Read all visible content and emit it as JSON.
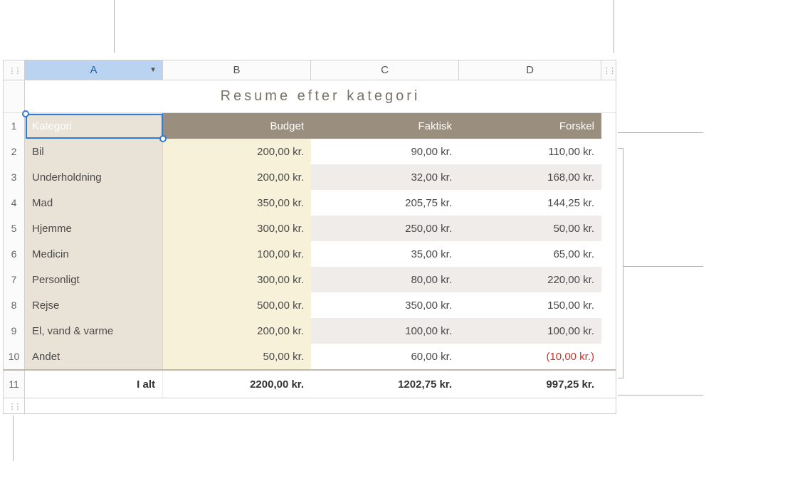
{
  "columns": [
    "A",
    "B",
    "C",
    "D"
  ],
  "title": "Resume efter kategori",
  "headers": {
    "category": "Kategori",
    "budget": "Budget",
    "actual": "Faktisk",
    "diff": "Forskel"
  },
  "rows": [
    {
      "n": "2",
      "cat": "Bil",
      "b": "200,00 kr.",
      "c": "90,00 kr.",
      "d": "110,00 kr."
    },
    {
      "n": "3",
      "cat": "Underholdning",
      "b": "200,00 kr.",
      "c": "32,00 kr.",
      "d": "168,00 kr."
    },
    {
      "n": "4",
      "cat": "Mad",
      "b": "350,00 kr.",
      "c": "205,75 kr.",
      "d": "144,25 kr."
    },
    {
      "n": "5",
      "cat": "Hjemme",
      "b": "300,00 kr.",
      "c": "250,00 kr.",
      "d": "50,00 kr."
    },
    {
      "n": "6",
      "cat": "Medicin",
      "b": "100,00 kr.",
      "c": "35,00 kr.",
      "d": "65,00 kr."
    },
    {
      "n": "7",
      "cat": "Personligt",
      "b": "300,00 kr.",
      "c": "80,00 kr.",
      "d": "220,00 kr."
    },
    {
      "n": "8",
      "cat": "Rejse",
      "b": "500,00 kr.",
      "c": "350,00 kr.",
      "d": "150,00 kr."
    },
    {
      "n": "9",
      "cat": "El, vand & varme",
      "b": "200,00 kr.",
      "c": "100,00 kr.",
      "d": "100,00 kr."
    },
    {
      "n": "10",
      "cat": "Andet",
      "b": "50,00 kr.",
      "c": "60,00 kr.",
      "d": "(10,00 kr.)",
      "neg": true
    }
  ],
  "total": {
    "n": "11",
    "label": "I alt",
    "b": "2200,00 kr.",
    "c": "1202,75 kr.",
    "d": "997,25 kr."
  },
  "header_row_n": "1",
  "chart_data": {
    "type": "table",
    "title": "Resume efter kategori",
    "columns": [
      "Kategori",
      "Budget",
      "Faktisk",
      "Forskel"
    ],
    "rows": [
      [
        "Bil",
        200.0,
        90.0,
        110.0
      ],
      [
        "Underholdning",
        200.0,
        32.0,
        168.0
      ],
      [
        "Mad",
        350.0,
        205.75,
        144.25
      ],
      [
        "Hjemme",
        300.0,
        250.0,
        50.0
      ],
      [
        "Medicin",
        100.0,
        35.0,
        65.0
      ],
      [
        "Personligt",
        300.0,
        80.0,
        220.0
      ],
      [
        "Rejse",
        500.0,
        350.0,
        150.0
      ],
      [
        "El, vand & varme",
        200.0,
        100.0,
        100.0
      ],
      [
        "Andet",
        50.0,
        60.0,
        -10.0
      ]
    ],
    "totals": [
      "I alt",
      2200.0,
      1202.75,
      997.25
    ],
    "currency": "kr."
  }
}
